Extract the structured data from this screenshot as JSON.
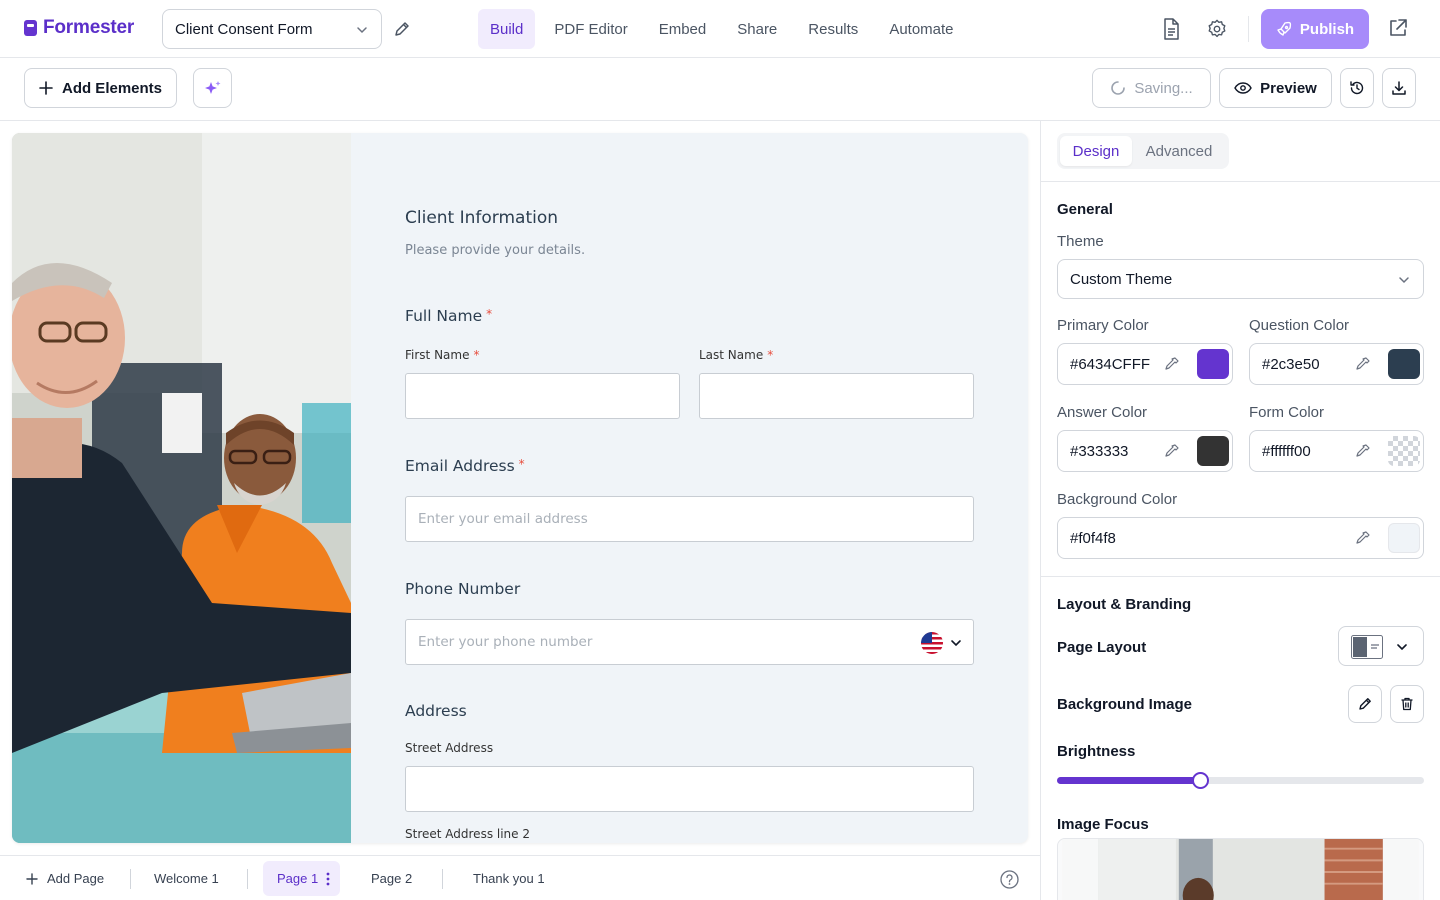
{
  "app": {
    "name": "Formester"
  },
  "topbar": {
    "form_title": "Client Consent Form",
    "nav": [
      {
        "label": "Build",
        "active": true
      },
      {
        "label": "PDF Editor"
      },
      {
        "label": "Embed"
      },
      {
        "label": "Share"
      },
      {
        "label": "Results"
      },
      {
        "label": "Automate"
      }
    ],
    "publish_label": "Publish"
  },
  "toolbar": {
    "add_elements_label": "Add Elements",
    "saving_label": "Saving...",
    "preview_label": "Preview"
  },
  "form": {
    "title": "Client Information",
    "subtitle": "Please provide your details.",
    "full_name": {
      "label": "Full Name",
      "required": "*",
      "first_label": "First Name",
      "last_label": "Last Name"
    },
    "email": {
      "label": "Email Address",
      "required": "*",
      "placeholder": "Enter your email address"
    },
    "phone": {
      "label": "Phone Number",
      "placeholder": "Enter your phone number"
    },
    "address": {
      "label": "Address",
      "street_label": "Street Address",
      "street2_label": "Street Address line 2"
    }
  },
  "bottombar": {
    "add_page_label": "Add Page",
    "pages": [
      {
        "label": "Welcome 1"
      },
      {
        "label": "Page 1",
        "active": true
      },
      {
        "label": "Page 2"
      },
      {
        "label": "Thank you 1"
      }
    ]
  },
  "panel": {
    "tabs": {
      "design": "Design",
      "advanced": "Advanced"
    },
    "general_heading": "General",
    "theme_label": "Theme",
    "theme_value": "Custom Theme",
    "colors": {
      "primary": {
        "label": "Primary Color",
        "value": "#6434CFFF",
        "swatch": "#6434cf"
      },
      "question": {
        "label": "Question Color",
        "value": "#2c3e50",
        "swatch": "#2c3e50"
      },
      "answer": {
        "label": "Answer Color",
        "value": "#333333",
        "swatch": "#333333"
      },
      "form": {
        "label": "Form Color",
        "value": "#ffffff00",
        "swatch": "transparent"
      },
      "background": {
        "label": "Background Color",
        "value": "#f0f4f8",
        "swatch": "#f0f4f8"
      }
    },
    "layout_heading": "Layout & Branding",
    "page_layout_label": "Page Layout",
    "background_image_label": "Background Image",
    "brightness_label": "Brightness",
    "brightness_value": 0.39,
    "image_focus_label": "Image Focus"
  }
}
